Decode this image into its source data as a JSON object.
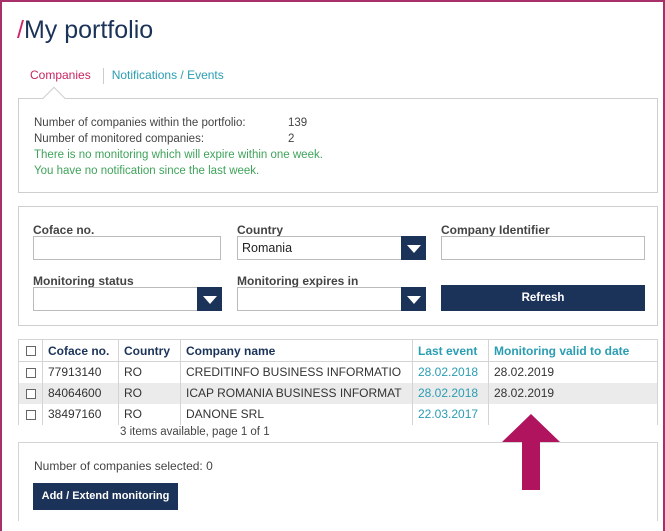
{
  "page": {
    "slash": "/",
    "title": "My portfolio"
  },
  "tabs": {
    "active": "Companies",
    "other": "Notifications / Events"
  },
  "info": {
    "companies_label": "Number of companies within the portfolio:",
    "companies_value": "139",
    "monitored_label": "Number of monitored companies:",
    "monitored_value": "2",
    "expire_note": "There is no monitoring which will expire within one week.",
    "notification_note": "You have no notification since the last week."
  },
  "filters": {
    "coface_label": "Coface no.",
    "coface_value": "",
    "country_label": "Country",
    "country_value": "Romania",
    "identifier_label": "Company Identifier",
    "identifier_value": "",
    "status_label": "Monitoring status",
    "status_value": "",
    "expires_label": "Monitoring expires in",
    "expires_value": "",
    "refresh_label": "Refresh"
  },
  "table": {
    "headers": [
      "Coface no.",
      "Country",
      "Company name",
      "Last event",
      "Monitoring valid to date"
    ],
    "rows": [
      {
        "coface": "77913140",
        "country": "RO",
        "name": "CREDITINFO BUSINESS INFORMATIO",
        "last_event": "28.02.2018",
        "valid_to": "28.02.2019"
      },
      {
        "coface": "84064600",
        "country": "RO",
        "name": "ICAP ROMANIA BUSINESS INFORMAT",
        "last_event": "28.02.2018",
        "valid_to": "28.02.2019"
      },
      {
        "coface": "38497160",
        "country": "RO",
        "name": "DANONE SRL",
        "last_event": "22.03.2017",
        "valid_to": ""
      }
    ],
    "pager": "3 items available, page 1 of 1"
  },
  "bottom": {
    "selected_text": "Number of companies selected: 0",
    "add_button": "Add / Extend monitoring"
  },
  "colors": {
    "navy": "#1b3358",
    "accent_pink": "#d0246b",
    "teal": "#2a9db3",
    "green": "#3fa35a",
    "arrow": "#b0145f"
  },
  "icons": [
    "dropdown-arrow-icon",
    "checkbox-icon",
    "up-arrow-indicator-icon"
  ]
}
